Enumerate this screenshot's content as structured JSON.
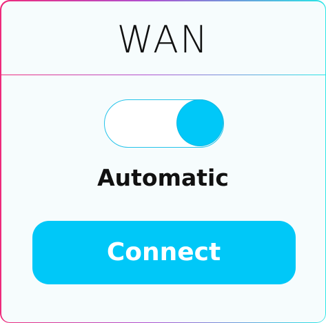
{
  "panel": {
    "title": "WAN"
  },
  "toggle": {
    "state": "on",
    "label": "Automatic"
  },
  "connect_button": {
    "label": "Connect"
  },
  "colors": {
    "accent": "#00c8f8",
    "border_gradient": [
      "#ee2a7b",
      "#28e6e6"
    ],
    "background": "#f6fcfd",
    "text": "#111111"
  }
}
